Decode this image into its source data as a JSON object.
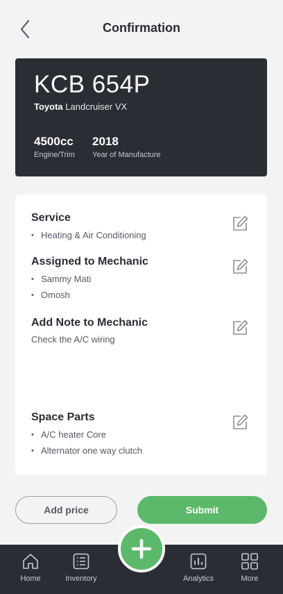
{
  "header": {
    "title": "Confirmation"
  },
  "vehicle": {
    "plate": "KCB 654P",
    "make": "Toyota",
    "model": "Landcruiser VX",
    "engine_value": "4500cc",
    "engine_label": "Engine/Trim",
    "year_value": "2018",
    "year_label": "Year of Manufacture"
  },
  "details": {
    "service": {
      "title": "Service",
      "items": [
        "Heating & Air Conditioning"
      ]
    },
    "mechanic": {
      "title": "Assigned to Mechanic",
      "items": [
        "Sammy Mati",
        "Omosh"
      ]
    },
    "note": {
      "title": "Add Note to Mechanic",
      "text": "Check the A/C wiring"
    },
    "parts": {
      "title": "Space Parts",
      "items": [
        "A/C heater Core",
        "Alternator one way clutch"
      ]
    }
  },
  "actions": {
    "add_price": "Add price",
    "submit": "Submit"
  },
  "nav": {
    "home": "Home",
    "inventory": "Inventory",
    "analytics": "Analytics",
    "more": "More"
  },
  "colors": {
    "accent": "#5cb86a",
    "dark": "#2b2d35",
    "background": "#f3f3f4"
  },
  "icons": {
    "back": "chevron-left-icon",
    "edit": "edit-icon",
    "add": "plus-icon",
    "home": "home-icon",
    "inventory": "list-icon",
    "analytics": "bar-chart-icon",
    "more": "grid-icon"
  }
}
